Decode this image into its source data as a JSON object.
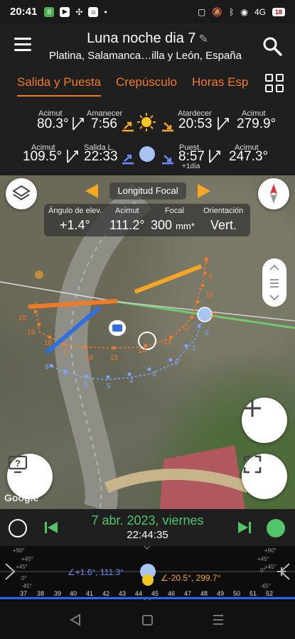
{
  "status": {
    "time": "20:41",
    "signal": "4G",
    "battery": "18"
  },
  "app": {
    "title": "Luna noche dia 7",
    "subtitle": "Platina, Salamanca…illa y León, España"
  },
  "tabs": [
    "Salida y Puesta",
    "Crepúsculo",
    "Horas Esp"
  ],
  "sun": {
    "rise_label": "Acimut",
    "rise_azimuth": "80.3°",
    "dawn_label": "Amanecer",
    "dawn_time": "7:56",
    "dusk_label": "Atardecer",
    "dusk_time": "20:53",
    "set_label": "Acimut",
    "set_azimuth": "279.9°"
  },
  "moon": {
    "rise_label": "Acimut",
    "rise_azimuth": "109.5°",
    "moonrise_label": "Salida L.",
    "moonrise_time": "22:33",
    "moonset_label": "Puest.",
    "moonset_time": "8:57",
    "moonset_note": "+1día",
    "set_label": "Acimut",
    "set_azimuth": "247.3°"
  },
  "map": {
    "focal_label": "Longitud Focal",
    "params": {
      "elev_label": "Ángulo de elev.",
      "elev_value": "+1.4°",
      "az_label": "Acimut",
      "az_value": "111.2°",
      "focal_label": "Focal",
      "focal_value": "300",
      "focal_unit": "mm*",
      "orient_label": "Orientación",
      "orient_value": "Vert."
    },
    "sun_hours": [
      "8",
      "9",
      "10",
      "11",
      "12",
      "13",
      "14",
      "15",
      "16",
      "17",
      "18",
      "19",
      "20"
    ],
    "moon_hours": [
      "0",
      "1",
      "2",
      "3",
      "4",
      "5",
      "6",
      "7",
      "8"
    ],
    "google": "Google"
  },
  "timeline": {
    "date": "7 abr. 2023, viernes",
    "time": "22:44:35"
  },
  "ruler": {
    "moon_pos": "∠+1.6°, 111.3°",
    "sun_pos": "∠-20.5°, 299.7°",
    "left_degs": [
      "+90°",
      "+45°",
      "+45°",
      "0°",
      "-45°"
    ],
    "right_degs": [
      "+90°",
      "+45°",
      "+45°",
      "0°",
      "-45°"
    ],
    "numbers": [
      "37",
      "38",
      "39",
      "40",
      "41",
      "42",
      "43",
      "44",
      "45",
      "46",
      "47",
      "48",
      "49",
      "50",
      "51",
      "52"
    ]
  },
  "colors": {
    "accent": "#f07a2a",
    "green": "#52c56a",
    "moon": "#a7c4f2",
    "sun": "#f6a623",
    "moonpath": "#6f8dff"
  }
}
